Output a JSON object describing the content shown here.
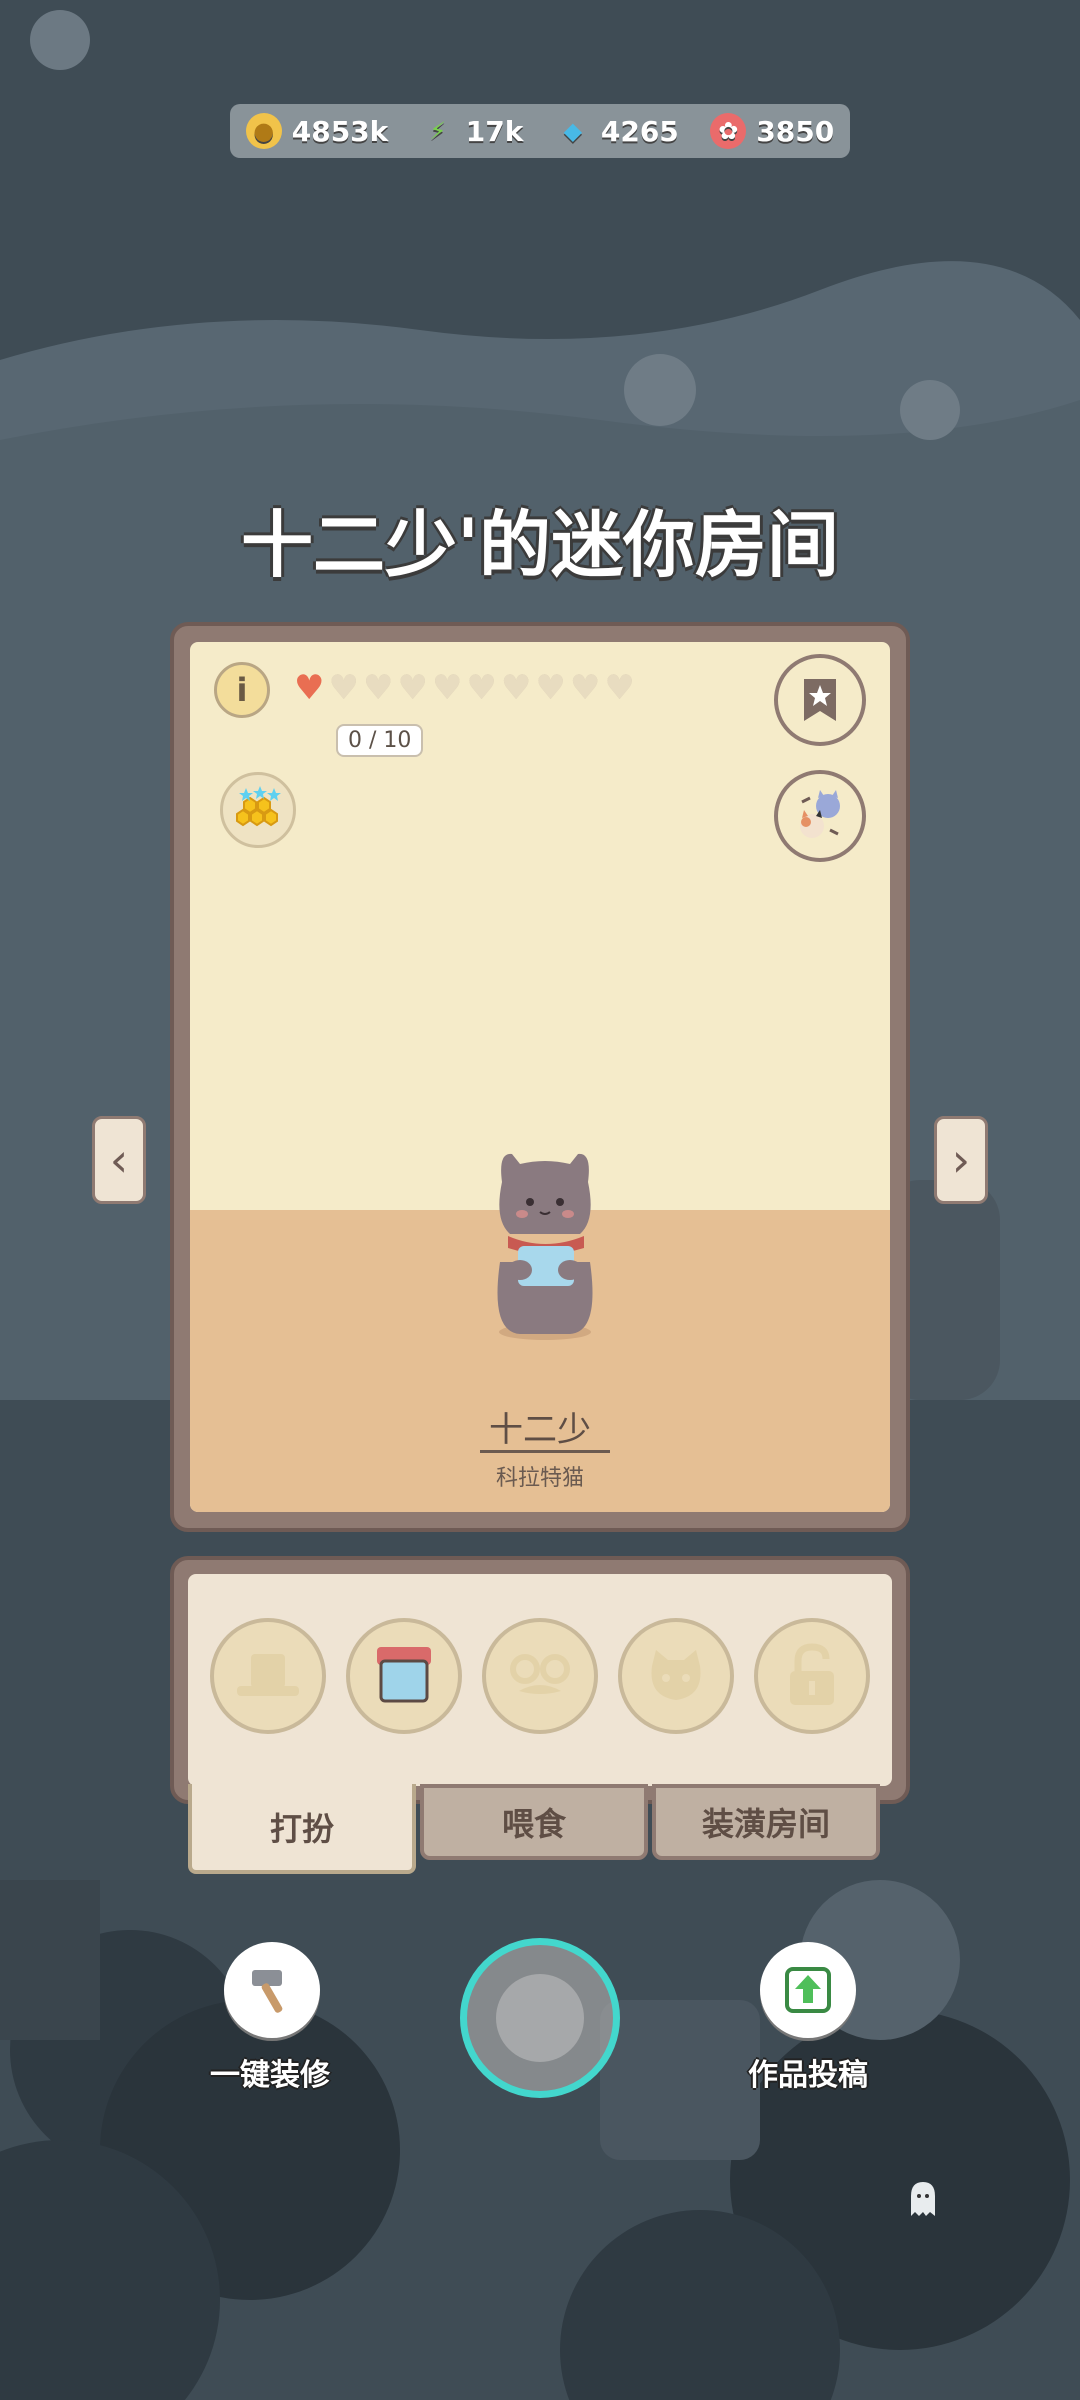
{
  "resources": [
    {
      "icon": "gold-coin-icon",
      "value": "4853k"
    },
    {
      "icon": "energy-bolt-icon",
      "value": "17k"
    },
    {
      "icon": "blue-gem-icon",
      "value": "4265"
    },
    {
      "icon": "red-candy-icon",
      "value": "3850"
    }
  ],
  "title": "十二少'的迷你房间",
  "room": {
    "info_label": "i",
    "hearts_filled": 1,
    "hearts_total": 10,
    "heart_progress": "0 / 10",
    "cat_name": "十二少",
    "cat_breed": "科拉特猫"
  },
  "navigation": {
    "prev_label": "‹",
    "next_label": "›"
  },
  "outfit_slots": [
    "hat-icon",
    "shirt-icon",
    "glasses-mustache-icon",
    "cat-face-icon",
    "locked-icon"
  ],
  "tabs": [
    {
      "label": "打扮",
      "active": true
    },
    {
      "label": "喂食",
      "active": false
    },
    {
      "label": "装潢房间",
      "active": false
    }
  ],
  "bottom_actions": {
    "left_label": "一键装修",
    "right_label": "作品投稿"
  },
  "colors": {
    "background": "#3f4c55",
    "card_frame": "#8f7a72",
    "wall": "#f5ebc9",
    "floor": "#e5bf94",
    "camera_ring": "#43d7cd"
  }
}
